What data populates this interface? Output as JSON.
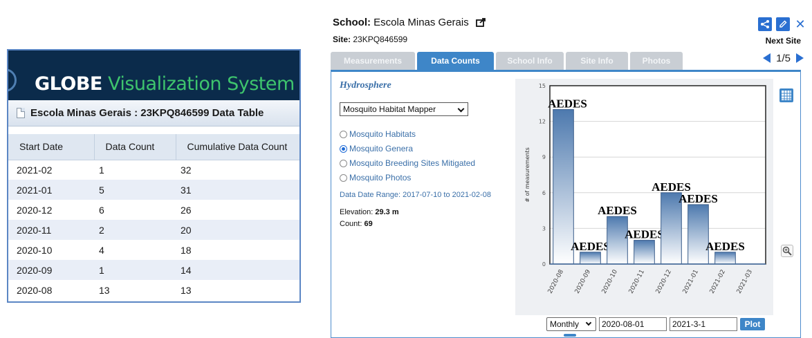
{
  "left": {
    "app_title_part1": "GLOBE",
    "app_title_part2": "Visualization System",
    "table_title": "Escola Minas Gerais : 23KPQ846599 Data Table",
    "columns": [
      "Start Date",
      "Data Count",
      "Cumulative Data Count"
    ],
    "rows": [
      [
        "2021-02",
        "1",
        "32"
      ],
      [
        "2021-01",
        "5",
        "31"
      ],
      [
        "2020-12",
        "6",
        "26"
      ],
      [
        "2020-11",
        "2",
        "20"
      ],
      [
        "2020-10",
        "4",
        "18"
      ],
      [
        "2020-09",
        "1",
        "14"
      ],
      [
        "2020-08",
        "13",
        "13"
      ]
    ]
  },
  "right": {
    "school_label": "School:",
    "school_name": "Escola Minas Gerais",
    "site_label": "Site:",
    "site_id": "23KPQ846599",
    "next_site": "Next Site",
    "pager": "1/5",
    "tabs": [
      "Measurements",
      "Data Counts",
      "School Info",
      "Site Info",
      "Photos"
    ],
    "active_tab": "Data Counts",
    "section_title": "Hydrosphere",
    "protocol_selected": "Mosquito Habitat Mapper",
    "radio_options": [
      {
        "label": "Mosquito Habitats",
        "checked": false
      },
      {
        "label": "Mosquito Genera",
        "checked": true
      },
      {
        "label": "Mosquito Breeding Sites Mitigated",
        "checked": false
      },
      {
        "label": "Mosquito Photos",
        "checked": false
      }
    ],
    "date_range": "Data Date Range: 2017-07-10 to 2021-02-08",
    "elevation_label": "Elevation:",
    "elevation_value": "29.3 m",
    "count_label": "Count:",
    "count_value": "69",
    "interval_selected": "Monthly",
    "start_date": "2020-08-01",
    "end_date": "2021-3-1",
    "plot_label": "Plot",
    "colors": {
      "accent": "#3e86c8",
      "header_bg": "#0b2b4b",
      "title_green": "#3ec46d"
    }
  },
  "chart_data": {
    "type": "bar",
    "categories": [
      "2020-08",
      "2020-09",
      "2020-10",
      "2020-11",
      "2020-12",
      "2021-01",
      "2021-02",
      "2021-03"
    ],
    "values": [
      13,
      1,
      4,
      2,
      6,
      5,
      1,
      0
    ],
    "bar_labels": [
      "AEDES",
      "AEDES",
      "AEDES",
      "AEDES",
      "AEDES",
      "AEDES",
      "AEDES",
      ""
    ],
    "ylabel": "# of measurements",
    "yticks": [
      0,
      3,
      6,
      9,
      12,
      15
    ],
    "ylim": [
      0,
      15
    ],
    "grid": true
  }
}
